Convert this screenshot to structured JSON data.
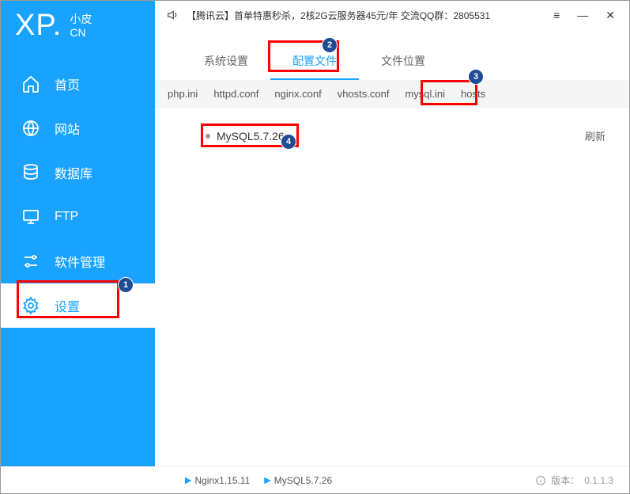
{
  "logo": {
    "main": "XP.",
    "sub1": "小皮",
    "sub2": "CN"
  },
  "sidebar": {
    "items": [
      {
        "label": "首页"
      },
      {
        "label": "网站"
      },
      {
        "label": "数据库"
      },
      {
        "label": "FTP"
      },
      {
        "label": "软件管理"
      },
      {
        "label": "设置"
      }
    ]
  },
  "topbar": {
    "text": "【腾讯云】首单特惠秒杀，2核2G云服务器45元/年 交流QQ群：2805531"
  },
  "tabs": [
    {
      "label": "系统设置"
    },
    {
      "label": "配置文件"
    },
    {
      "label": "文件位置"
    }
  ],
  "subtabs": [
    "php.ini",
    "httpd.conf",
    "nginx.conf",
    "vhosts.conf",
    "mysql.ini",
    "hosts"
  ],
  "content": {
    "items": [
      "MySQL5.7.26"
    ],
    "refresh": "刷新"
  },
  "status": {
    "services": [
      "Nginx1.15.11",
      "MySQL5.7.26"
    ],
    "version_label": "版本：",
    "version": "0.1.1.3"
  }
}
